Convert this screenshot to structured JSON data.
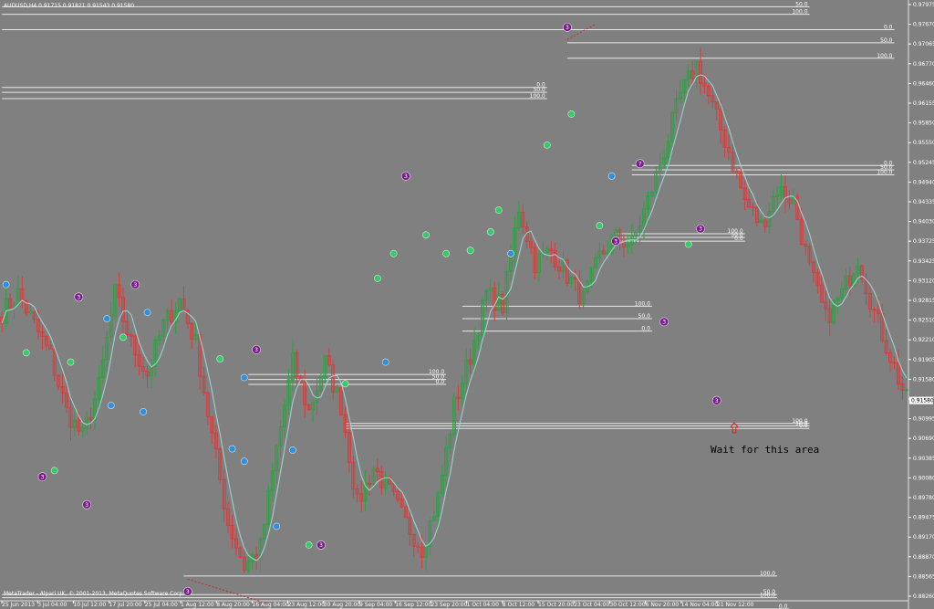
{
  "window": {
    "symbol_header": "AUDUSD,H4  0.91715 0.91821 0.91543 0.91580",
    "copyright": "MetaTrader - Alpari UK, © 2001-2013, MetaQuotes Software Corp."
  },
  "colors": {
    "background": "#808080",
    "bull": "#2ea043",
    "bear": "#d93b3b",
    "ma": "#9fd8d8",
    "purple": "#7a1e8c",
    "green_marker": "#33cc66",
    "blue_marker": "#2f8fe0",
    "level": "#e8e8e8"
  },
  "chart_data": {
    "type": "candlestick",
    "ylim": [
      0.8835,
      0.9801
    ],
    "price_ticks": [
      "0.97975",
      "0.97670",
      "0.97065",
      "0.96770",
      "0.96460",
      "0.96155",
      "0.95850",
      "0.95550",
      "0.95245",
      "0.94940",
      "0.94335",
      "0.94030",
      "0.93725",
      "0.93425",
      "0.93120",
      "0.92815",
      "0.92510",
      "0.92210",
      "0.91905",
      "0.91580",
      "0.91295",
      "0.90995",
      "0.90690",
      "0.90385",
      "0.90080",
      "0.89780",
      "0.89475",
      "0.89170",
      "0.88870",
      "0.88565",
      "0.88260"
    ],
    "current_price": "0.91580",
    "time_labels": [
      "25 Jun 2013",
      "3 Jul 04:00",
      "10 Jul 12:00",
      "17 Jul 20:00",
      "25 Jul 04:00",
      "1 Aug 12:00",
      "8 Aug 20:00",
      "16 Aug 04:00",
      "23 Aug 12:00",
      "30 Aug 20:00",
      "9 Sep 04:00",
      "16 Sep 12:00",
      "23 Sep 20:00",
      "1 Oct 04:00",
      "8 Oct 12:00",
      "15 Oct 20:00",
      "23 Oct 04:00",
      "30 Oct 12:00",
      "6 Nov 20:00",
      "14 Nov 04:00",
      "21 Nov 12:00"
    ],
    "waypoints": [
      [
        0,
        0.93
      ],
      [
        4,
        0.933
      ],
      [
        8,
        0.928
      ],
      [
        12,
        0.923
      ],
      [
        16,
        0.914
      ],
      [
        20,
        0.91
      ],
      [
        24,
        0.918
      ],
      [
        28,
        0.933
      ],
      [
        32,
        0.925
      ],
      [
        36,
        0.92
      ],
      [
        40,
        0.928
      ],
      [
        44,
        0.932
      ],
      [
        48,
        0.925
      ],
      [
        52,
        0.91
      ],
      [
        56,
        0.896
      ],
      [
        60,
        0.889
      ],
      [
        64,
        0.892
      ],
      [
        68,
        0.908
      ],
      [
        72,
        0.922
      ],
      [
        76,
        0.914
      ],
      [
        80,
        0.922
      ],
      [
        84,
        0.915
      ],
      [
        88,
        0.899
      ],
      [
        92,
        0.905
      ],
      [
        96,
        0.901
      ],
      [
        100,
        0.896
      ],
      [
        104,
        0.892
      ],
      [
        108,
        0.9
      ],
      [
        112,
        0.915
      ],
      [
        116,
        0.923
      ],
      [
        120,
        0.933
      ],
      [
        124,
        0.931
      ],
      [
        128,
        0.947
      ],
      [
        132,
        0.938
      ],
      [
        136,
        0.94
      ],
      [
        140,
        0.936
      ],
      [
        144,
        0.932
      ],
      [
        148,
        0.939
      ],
      [
        152,
        0.942
      ],
      [
        156,
        0.941
      ],
      [
        160,
        0.948
      ],
      [
        164,
        0.956
      ],
      [
        168,
        0.965
      ],
      [
        172,
        0.97
      ],
      [
        176,
        0.963
      ],
      [
        180,
        0.956
      ],
      [
        184,
        0.948
      ],
      [
        188,
        0.944
      ],
      [
        192,
        0.95
      ],
      [
        196,
        0.948
      ],
      [
        200,
        0.937
      ],
      [
        204,
        0.929
      ],
      [
        208,
        0.933
      ],
      [
        212,
        0.939
      ],
      [
        216,
        0.93
      ],
      [
        220,
        0.923
      ],
      [
        224,
        0.9158
      ]
    ],
    "bars_total": 225,
    "plot_x_range": [
      0,
      996
    ],
    "markers": [
      {
        "type": "blue",
        "t": 1,
        "p": 0.9345
      },
      {
        "type": "purple",
        "label": "3",
        "t": 19,
        "p": 0.9325
      },
      {
        "type": "blue",
        "t": 26,
        "p": 0.929
      },
      {
        "type": "purple",
        "label": "3",
        "t": 33,
        "p": 0.9345
      },
      {
        "type": "blue",
        "t": 36,
        "p": 0.93
      },
      {
        "type": "purple",
        "label": "3",
        "t": 10,
        "p": 0.9035
      },
      {
        "type": "purple",
        "label": "3",
        "t": 21,
        "p": 0.899
      },
      {
        "type": "blue",
        "t": 27,
        "p": 0.915
      },
      {
        "type": "blue",
        "t": 35,
        "p": 0.914
      },
      {
        "type": "green",
        "t": 6,
        "p": 0.9235
      },
      {
        "type": "green",
        "t": 17,
        "p": 0.922
      },
      {
        "type": "green",
        "t": 30,
        "p": 0.926
      },
      {
        "type": "green",
        "t": 13,
        "p": 0.9045
      },
      {
        "type": "purple",
        "label": "3",
        "t": 46,
        "p": 0.885
      },
      {
        "type": "green",
        "t": 54,
        "p": 0.9225
      },
      {
        "type": "purple",
        "label": "3",
        "t": 63,
        "p": 0.924
      },
      {
        "type": "blue",
        "t": 60,
        "p": 0.9195
      },
      {
        "type": "blue",
        "t": 57,
        "p": 0.908
      },
      {
        "type": "blue",
        "t": 60,
        "p": 0.906
      },
      {
        "type": "blue",
        "t": 72,
        "p": 0.9078
      },
      {
        "type": "blue",
        "t": 68,
        "p": 0.8955
      },
      {
        "type": "green",
        "t": 76,
        "p": 0.8925
      },
      {
        "type": "purple",
        "label": "3",
        "t": 79,
        "p": 0.8925
      },
      {
        "type": "green",
        "t": 85,
        "p": 0.9185
      },
      {
        "type": "blue",
        "t": 95,
        "p": 0.922
      },
      {
        "type": "green",
        "t": 93,
        "p": 0.9355
      },
      {
        "type": "green",
        "t": 97,
        "p": 0.9395
      },
      {
        "type": "purple",
        "label": "3",
        "t": 100,
        "p": 0.952
      },
      {
        "type": "green",
        "t": 105,
        "p": 0.9425
      },
      {
        "type": "green",
        "t": 110,
        "p": 0.9395
      },
      {
        "type": "green",
        "t": 116,
        "p": 0.94
      },
      {
        "type": "green",
        "t": 121,
        "p": 0.943
      },
      {
        "type": "blue",
        "t": 126,
        "p": 0.9395
      },
      {
        "type": "green",
        "t": 123,
        "p": 0.9465
      },
      {
        "type": "green",
        "t": 135,
        "p": 0.957
      },
      {
        "type": "purple",
        "label": "3",
        "t": 140,
        "p": 0.976
      },
      {
        "type": "green",
        "t": 141,
        "p": 0.962
      },
      {
        "type": "blue",
        "t": 151,
        "p": 0.952
      },
      {
        "type": "green",
        "t": 148,
        "p": 0.944
      },
      {
        "type": "purple",
        "label": "3",
        "t": 152,
        "p": 0.9415
      },
      {
        "type": "purple",
        "label": "7",
        "t": 158,
        "p": 0.954
      },
      {
        "type": "purple",
        "label": "3",
        "t": 164,
        "p": 0.9285
      },
      {
        "type": "purple",
        "label": "3",
        "t": 173,
        "p": 0.9435
      },
      {
        "type": "green",
        "t": 170,
        "p": 0.941
      },
      {
        "type": "purple",
        "label": "3",
        "t": 177,
        "p": 0.9158
      }
    ],
    "levels": [
      {
        "t1": 0,
        "t2": 200,
        "p": 0.9793,
        "label": "50.0"
      },
      {
        "t1": 0,
        "t2": 200,
        "p": 0.9781,
        "label": "100.0"
      },
      {
        "t1": 0,
        "t2": 221,
        "p": 0.9756,
        "label": "0.0"
      },
      {
        "t1": 140,
        "t2": 221,
        "p": 0.9735,
        "label": "50.0"
      },
      {
        "t1": 140,
        "t2": 221,
        "p": 0.971,
        "label": "100.0"
      },
      {
        "t1": 0,
        "t2": 135,
        "p": 0.9663,
        "label": "0.0"
      },
      {
        "t1": 0,
        "t2": 135,
        "p": 0.9655,
        "label": "50.0"
      },
      {
        "t1": 0,
        "t2": 135,
        "p": 0.9645,
        "label": "100.0"
      },
      {
        "t1": 156,
        "t2": 221,
        "p": 0.9537,
        "label": "0.0"
      },
      {
        "t1": 156,
        "t2": 221,
        "p": 0.953,
        "label": "50.0"
      },
      {
        "t1": 156,
        "t2": 221,
        "p": 0.9522,
        "label": "100.0"
      },
      {
        "t1": 152,
        "t2": 184,
        "p": 0.9427,
        "label": "100.0"
      },
      {
        "t1": 152,
        "t2": 184,
        "p": 0.9421,
        "label": "50.0"
      },
      {
        "t1": 152,
        "t2": 184,
        "p": 0.9415,
        "label": "0.0"
      },
      {
        "t1": 114,
        "t2": 161,
        "p": 0.931,
        "label": "100.0"
      },
      {
        "t1": 114,
        "t2": 161,
        "p": 0.929,
        "label": "50.0"
      },
      {
        "t1": 114,
        "t2": 161,
        "p": 0.927,
        "label": "0.0"
      },
      {
        "t1": 61,
        "t2": 110,
        "p": 0.92,
        "label": "100.0"
      },
      {
        "t1": 61,
        "t2": 110,
        "p": 0.9192,
        "label": "50.0"
      },
      {
        "t1": 61,
        "t2": 110,
        "p": 0.9184,
        "label": "0.0"
      },
      {
        "t1": 85,
        "t2": 200,
        "p": 0.9121,
        "label": "100.0"
      },
      {
        "t1": 85,
        "t2": 200,
        "p": 0.9117,
        "label": "50.0"
      },
      {
        "t1": 85,
        "t2": 200,
        "p": 0.9113,
        "label": "0.0"
      },
      {
        "t1": 45,
        "t2": 192,
        "p": 0.8875,
        "label": "100.0"
      },
      {
        "t1": 0,
        "t2": 192,
        "p": 0.8845,
        "label": "50.0"
      },
      {
        "t1": 0,
        "t2": 192,
        "p": 0.884,
        "label": "100.0"
      },
      {
        "t1": 45,
        "t2": 195,
        "p": 0.8822,
        "label": "0.0"
      }
    ],
    "annotation": "Wait for this area",
    "arrow_at": {
      "t": 180,
      "p": 0.9118
    }
  }
}
